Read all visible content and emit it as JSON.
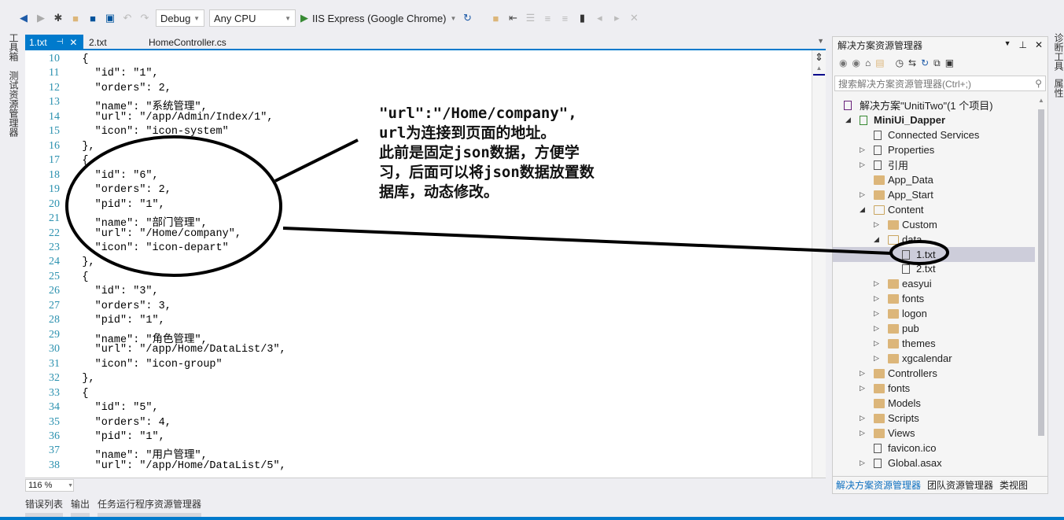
{
  "toolbar": {
    "config": "Debug",
    "platform": "Any CPU",
    "run_target": "IIS Express (Google Chrome)"
  },
  "left_strip": [
    "工具箱",
    "测试资源管理器"
  ],
  "right_strip": [
    "诊断工具",
    "属性"
  ],
  "tabs": [
    {
      "label": "1.txt",
      "active": true
    },
    {
      "label": "2.txt"
    },
    {
      "label": "HomeController.cs"
    }
  ],
  "editor": {
    "first_line": 10,
    "lines": [
      "    {",
      "      \"id\": \"1\",",
      "      \"orders\": 2,",
      "      \"name\": \"系统管理\",",
      "      \"url\": \"/app/Admin/Index/1\",",
      "      \"icon\": \"icon-system\"",
      "    },",
      "    {",
      "      \"id\": \"6\",",
      "      \"orders\": 2,",
      "      \"pid\": \"1\",",
      "      \"name\": \"部门管理\",",
      "      \"url\": \"/Home/company\",",
      "      \"icon\": \"icon-depart\"",
      "    },",
      "    {",
      "      \"id\": \"3\",",
      "      \"orders\": 3,",
      "      \"pid\": \"1\",",
      "      \"name\": \"角色管理\",",
      "      \"url\": \"/app/Home/DataList/3\",",
      "      \"icon\": \"icon-group\"",
      "    },",
      "    {",
      "      \"id\": \"5\",",
      "      \"orders\": 4,",
      "      \"pid\": \"1\",",
      "      \"name\": \"用户管理\",",
      "      \"url\": \"/app/Home/DataList/5\","
    ],
    "zoom": "116 %"
  },
  "annotation": "\"url\":\"/Home/company\",\nurl为连接到页面的地址。\n此前是固定json数据，方便学\n习，后面可以将json数据放置数\n据库，动态修改。",
  "bottom_tabs": [
    "错误列表",
    "输出",
    "任务运行程序资源管理器"
  ],
  "solution_explorer": {
    "title": "解决方案资源管理器",
    "search_placeholder": "搜索解决方案资源管理器(Ctrl+;)",
    "tree": [
      {
        "label": "解决方案\"UnitiTwo\"(1 个项目)",
        "level": 0,
        "icon": "solution-icon"
      },
      {
        "label": "MiniUi_Dapper",
        "level": 1,
        "expanded": true,
        "icon": "web-project-icon",
        "bold": true
      },
      {
        "label": "Connected Services",
        "level": 2,
        "icon": "cloud-icon"
      },
      {
        "label": "Properties",
        "level": 2,
        "collapsed": true,
        "icon": "wrench-icon"
      },
      {
        "label": "引用",
        "level": 2,
        "collapsed": true,
        "icon": "references-icon"
      },
      {
        "label": "App_Data",
        "level": 2,
        "icon": "folder-icon"
      },
      {
        "label": "App_Start",
        "level": 2,
        "collapsed": true,
        "icon": "folder-icon"
      },
      {
        "label": "Content",
        "level": 2,
        "expanded": true,
        "icon": "folder-open-icon"
      },
      {
        "label": "Custom",
        "level": 3,
        "collapsed": true,
        "icon": "folder-icon"
      },
      {
        "label": "data",
        "level": 3,
        "expanded": true,
        "icon": "folder-open-icon"
      },
      {
        "label": "1.txt",
        "level": 4,
        "icon": "file-icon",
        "selected": true
      },
      {
        "label": "2.txt",
        "level": 4,
        "icon": "file-icon"
      },
      {
        "label": "easyui",
        "level": 3,
        "collapsed": true,
        "icon": "folder-icon"
      },
      {
        "label": "fonts",
        "level": 3,
        "collapsed": true,
        "icon": "folder-icon"
      },
      {
        "label": "logon",
        "level": 3,
        "collapsed": true,
        "icon": "folder-icon"
      },
      {
        "label": "pub",
        "level": 3,
        "collapsed": true,
        "icon": "folder-icon"
      },
      {
        "label": "themes",
        "level": 3,
        "collapsed": true,
        "icon": "folder-icon"
      },
      {
        "label": "xgcalendar",
        "level": 3,
        "collapsed": true,
        "icon": "folder-icon"
      },
      {
        "label": "Controllers",
        "level": 2,
        "collapsed": true,
        "icon": "folder-icon"
      },
      {
        "label": "fonts",
        "level": 2,
        "collapsed": true,
        "icon": "folder-icon"
      },
      {
        "label": "Models",
        "level": 2,
        "icon": "folder-icon"
      },
      {
        "label": "Scripts",
        "level": 2,
        "collapsed": true,
        "icon": "folder-icon"
      },
      {
        "label": "Views",
        "level": 2,
        "collapsed": true,
        "icon": "folder-icon"
      },
      {
        "label": "favicon.ico",
        "level": 2,
        "icon": "file-icon"
      },
      {
        "label": "Global.asax",
        "level": 2,
        "collapsed": true,
        "icon": "gear-file-icon"
      }
    ],
    "bottom_tabs": [
      "解决方案资源管理器",
      "团队资源管理器",
      "类视图"
    ]
  },
  "colors": {
    "accent": "#007acc",
    "line_number": "#2b91af",
    "folder": "#dcb67a",
    "selected_row": "#cdcdda"
  }
}
